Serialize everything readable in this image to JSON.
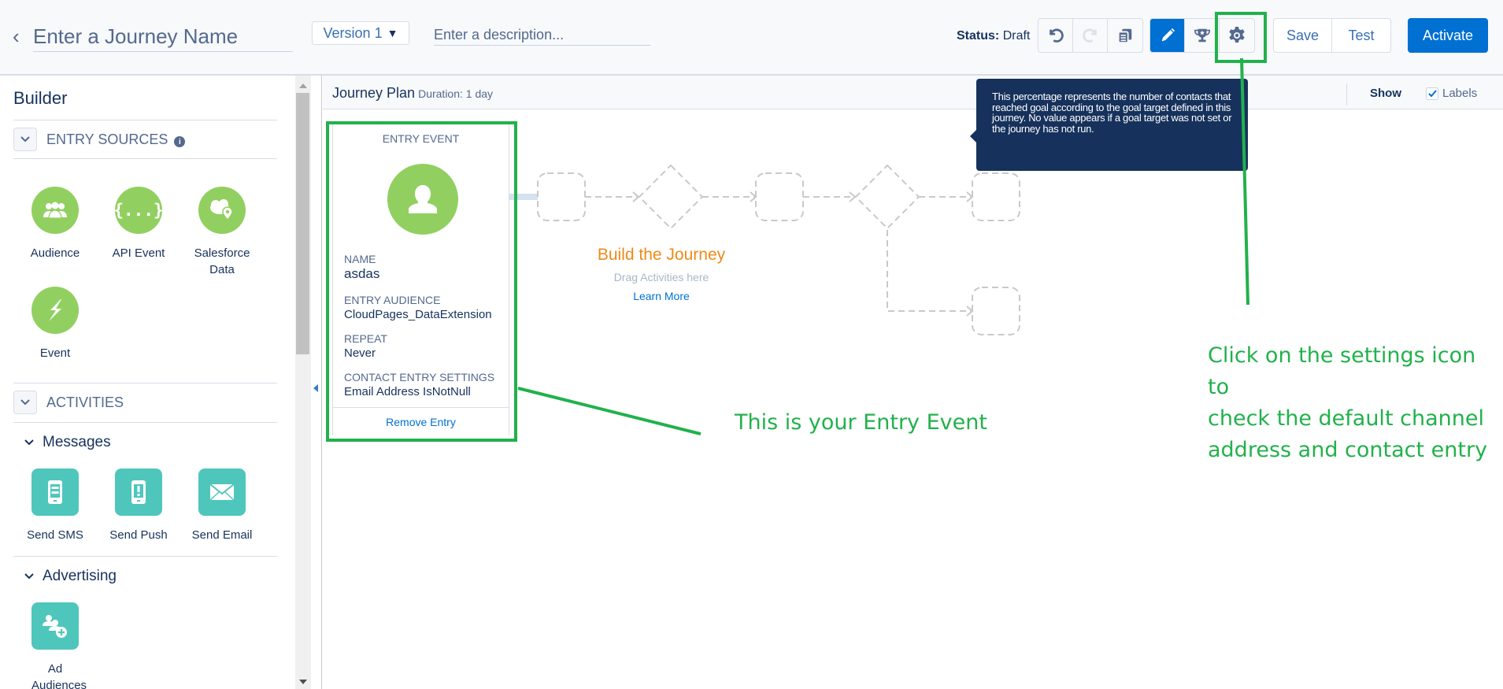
{
  "header": {
    "back_icon": "chevron-left-icon",
    "journey_name_placeholder": "Enter a Journey Name",
    "version_label": "Version 1",
    "description_placeholder": "Enter a description...",
    "status_label": "Status:",
    "status_value": "Draft",
    "toolbar_icons": [
      "undo-icon",
      "redo-icon",
      "copy-icon",
      "pencil-icon",
      "trophy-icon",
      "gear-icon"
    ],
    "save_label": "Save",
    "test_label": "Test",
    "activate_label": "Activate"
  },
  "sidebar": {
    "title": "Builder",
    "entry_sources": {
      "label": "ENTRY SOURCES",
      "info_glyph": "i",
      "items": [
        {
          "label": "Audience",
          "icon": "audience-icon"
        },
        {
          "label": "API Event",
          "icon": "api-event-icon"
        },
        {
          "label": "Salesforce Data",
          "icon": "salesforce-data-icon"
        },
        {
          "label": "Event",
          "icon": "event-icon"
        }
      ]
    },
    "activities": {
      "label": "ACTIVITIES",
      "groups": [
        {
          "label": "Messages",
          "items": [
            {
              "label": "Send SMS",
              "icon": "sms-icon"
            },
            {
              "label": "Send Push",
              "icon": "push-icon"
            },
            {
              "label": "Send Email",
              "icon": "email-icon"
            }
          ]
        },
        {
          "label": "Advertising",
          "items": [
            {
              "label": "Ad Audiences",
              "icon": "ad-audiences-icon"
            }
          ]
        }
      ]
    }
  },
  "canvas": {
    "title": "Journey Plan",
    "duration": "Duration: 1 day",
    "show_label": "Show",
    "labels_checkbox": {
      "label": "Labels",
      "checked": true
    },
    "entry_event": {
      "title": "ENTRY EVENT",
      "fields": [
        {
          "key": "NAME",
          "value": "asdas"
        },
        {
          "key": "ENTRY AUDIENCE",
          "value": "CloudPages_DataExtension"
        },
        {
          "key": "REPEAT",
          "value": "Never"
        },
        {
          "key": "CONTACT ENTRY SETTINGS",
          "value": "Email Address IsNotNull"
        }
      ],
      "remove_label": "Remove Entry"
    },
    "placeholder": {
      "title": "Build the Journey",
      "subtitle": "Drag Activities here",
      "link": "Learn More"
    },
    "tooltip": "This percentage represents the number of contacts that reached goal according to the goal target defined in this journey. No value appears if a goal target was not set or the journey has not run."
  },
  "annotations": {
    "entry_event": "This is your Entry Event",
    "settings": [
      "Click on the settings icon to",
      "check the default channel",
      "address and contact entry"
    ],
    "color": "#22b14c"
  },
  "colors": {
    "brand_blue": "#0070d2",
    "entry_green": "#91d060",
    "activity_teal": "#4fc6bc",
    "tooltip_navy": "#16325c",
    "placeholder_orange": "#ee8a17"
  }
}
